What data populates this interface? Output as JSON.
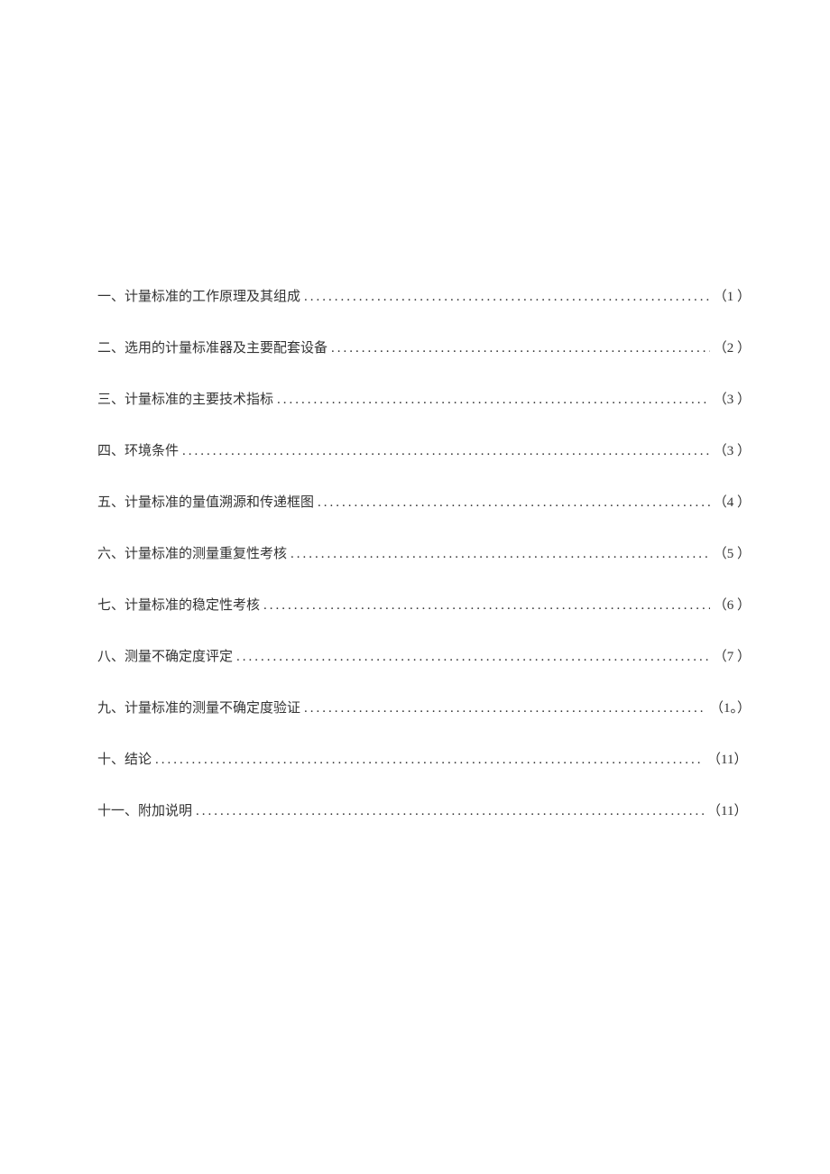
{
  "toc": {
    "entries": [
      {
        "title": "一、计量标准的工作原理及其组成",
        "page": "（1   ）"
      },
      {
        "title": "二、选用的计量标准器及主要配套设备",
        "page": "（2   ）"
      },
      {
        "title": "三、计量标准的主要技术指标",
        "page": "（3   ）"
      },
      {
        "title": "四、环境条件",
        "page": "（3   ）"
      },
      {
        "title": "五、计量标准的量值溯源和传递框图",
        "page": "（4   ）"
      },
      {
        "title": "六、计量标准的测量重复性考核",
        "page": "（5   ）"
      },
      {
        "title": "七、计量标准的稳定性考核",
        "page": "（6   ）"
      },
      {
        "title": "八、测量不确定度评定",
        "page": "（7   ）"
      },
      {
        "title": "九、计量标准的测量不确定度验证",
        "page": "（1。）"
      },
      {
        "title": "十、结论",
        "page": "（11）"
      },
      {
        "title": "十一、附加说明",
        "page": "（11）"
      }
    ],
    "leader": ".................................................................................................................."
  }
}
